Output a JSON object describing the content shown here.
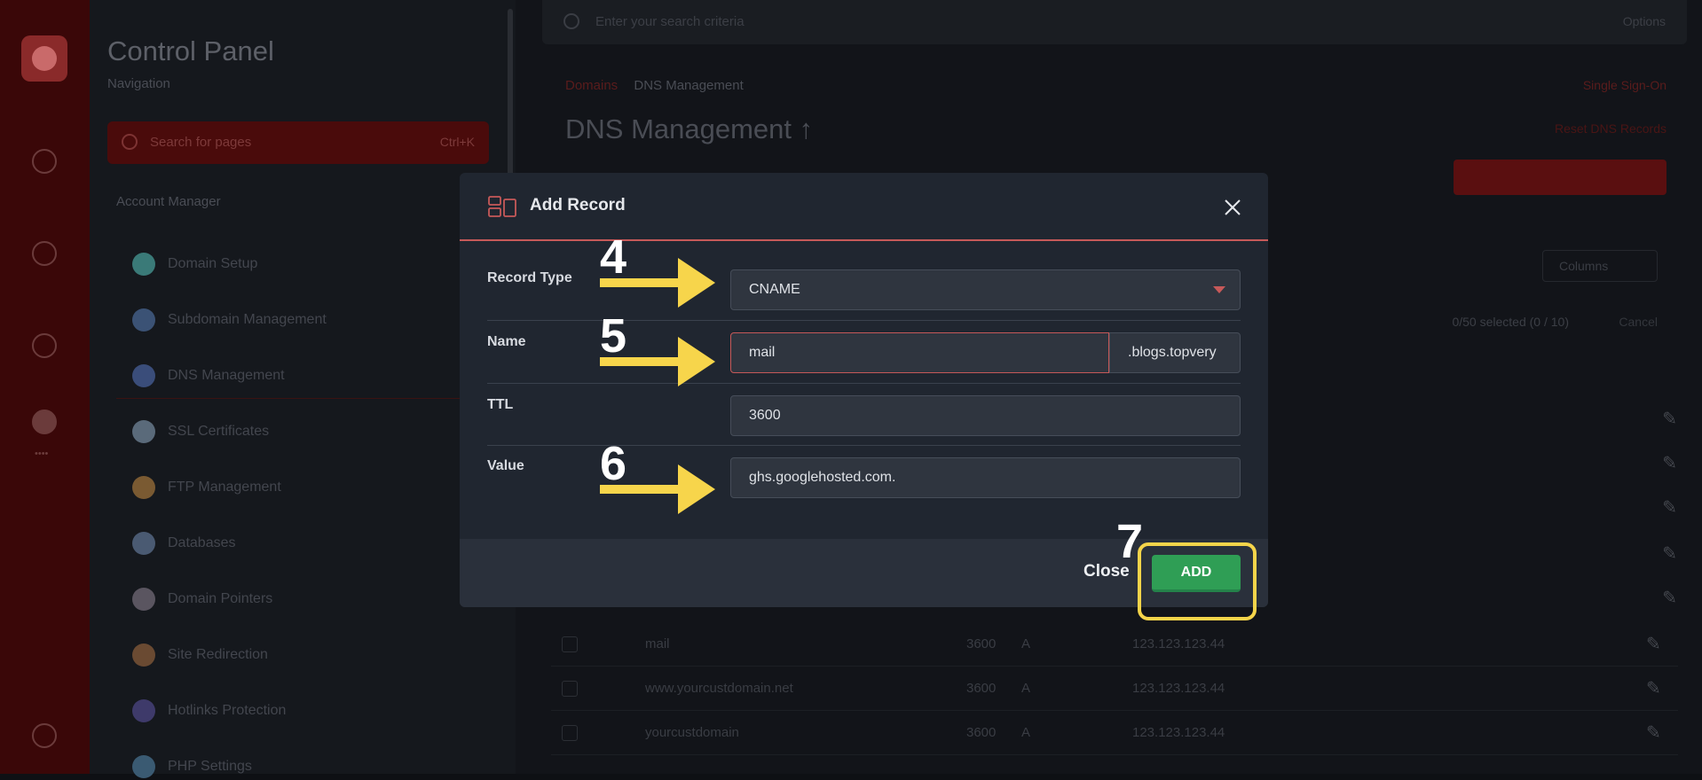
{
  "rail": {
    "label": "••••"
  },
  "sidebar": {
    "title": "Control Panel",
    "subtitle": "Navigation",
    "search_placeholder": "Search for pages",
    "search_shortcut": "Ctrl+K",
    "section": "Account Manager",
    "items": [
      {
        "label": "Domain Setup",
        "color": "#3a7a78"
      },
      {
        "label": "Subdomain Management",
        "color": "#3b5275"
      },
      {
        "label": "DNS Management",
        "color": "#3a4d7a"
      },
      {
        "label": "SSL Certificates",
        "color": "#5a6a7a"
      },
      {
        "label": "FTP Management",
        "color": "#7a5a32"
      },
      {
        "label": "Databases",
        "color": "#4a5a72"
      },
      {
        "label": "Domain Pointers",
        "color": "#5a5560"
      },
      {
        "label": "Site Redirection",
        "color": "#6a4a32"
      },
      {
        "label": "Hotlinks Protection",
        "color": "#3e3a6a"
      },
      {
        "label": "PHP Settings",
        "color": "#3a5a72"
      }
    ]
  },
  "topbar": {
    "search_placeholder": "Enter your search criteria",
    "right": "Options"
  },
  "breadcrumb": {
    "home": "Domains",
    "current": "DNS Management"
  },
  "breadcrumb_right": "Single Sign-On",
  "page": {
    "title": "DNS Management",
    "title_suffix": "↑",
    "link": "Reset DNS Records"
  },
  "columns_button": "Columns",
  "selection": {
    "text": "0/50 selected (0 / 10)",
    "cancel": "Cancel"
  },
  "rows": [
    {
      "name": "mail",
      "ttl": "3600",
      "type": "A",
      "value": "123.123.123.44"
    },
    {
      "name": "www.yourcustdomain.net",
      "ttl": "3600",
      "type": "A",
      "value": "123.123.123.44"
    },
    {
      "name": "yourcustdomain",
      "ttl": "3600",
      "type": "A",
      "value": "123.123.123.44"
    }
  ],
  "modal": {
    "title": "Add Record",
    "fields": {
      "record_type": {
        "label": "Record Type",
        "value": "CNAME"
      },
      "name": {
        "label": "Name",
        "value": "mail",
        "suffix": ".blogs.topvery"
      },
      "ttl": {
        "label": "TTL",
        "value": "3600"
      },
      "value": {
        "label": "Value",
        "value": "ghs.googlehosted.com."
      }
    },
    "close_label": "Close",
    "add_label": "ADD"
  },
  "annotations": {
    "steps": [
      "4",
      "5",
      "6",
      "7"
    ],
    "arrow_color": "#f7d54b",
    "highlight_color": "#f5d44a"
  },
  "colors": {
    "accent": "#c65959",
    "add_button": "#2f9e55",
    "modal_bg": "#202630",
    "footer_bg": "#2a303b"
  }
}
